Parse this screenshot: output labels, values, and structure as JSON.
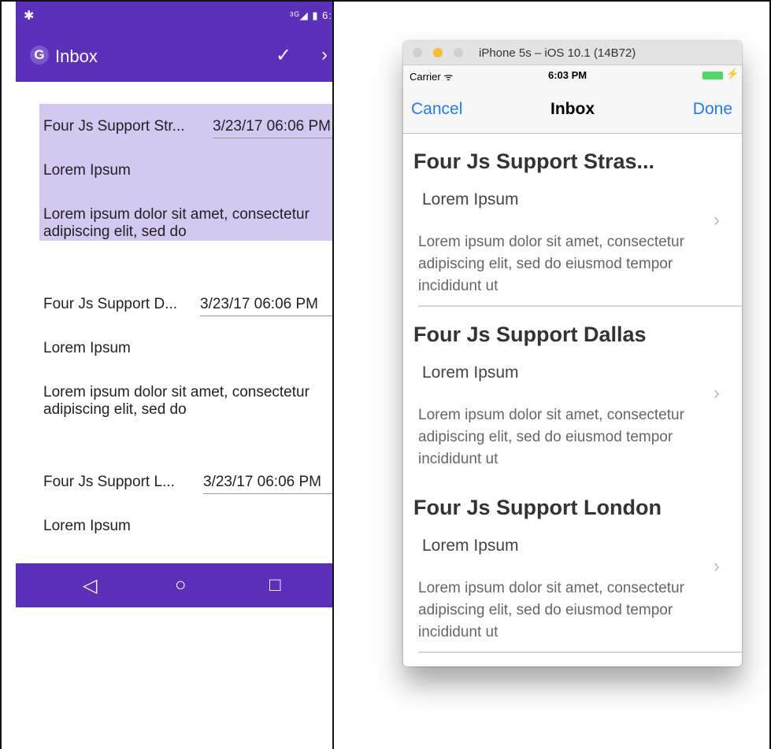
{
  "android": {
    "status_icons": "³ᴳ◢ ▮ 6:",
    "appbar": {
      "logo": "G",
      "title": "Inbox",
      "check": "✓",
      "more": "›"
    },
    "items": [
      {
        "sender": "Four Js Support Str...",
        "date": "3/23/17 06:06 PM",
        "subject": "Lorem Ipsum",
        "body": "Lorem ipsum dolor sit amet, consectetur adipiscing elit, sed do"
      },
      {
        "sender": "Four Js Support D...",
        "date": "3/23/17 06:06 PM",
        "subject": "Lorem Ipsum",
        "body": "Lorem ipsum dolor sit amet, consectetur adipiscing elit, sed do"
      },
      {
        "sender": "Four Js Support L...",
        "date": "3/23/17 06:06 PM",
        "subject": "Lorem Ipsum",
        "body": ""
      }
    ],
    "nav": {
      "back": "◁",
      "home": "○",
      "recents": "□"
    }
  },
  "ios": {
    "window_title": "iPhone 5s – iOS 10.1 (14B72)",
    "status": {
      "carrier": "Carrier ᯤ",
      "time": "6:03 PM",
      "bolt": "⚡"
    },
    "nav": {
      "cancel": "Cancel",
      "title": "Inbox",
      "done": "Done"
    },
    "items": [
      {
        "sender": "Four Js Support Stras...",
        "subject": "Lorem Ipsum",
        "body": "Lorem ipsum dolor sit amet, consectetur adipiscing elit, sed do eiusmod tempor incididunt ut"
      },
      {
        "sender": "Four Js Support Dallas",
        "subject": "Lorem Ipsum",
        "body": "Lorem ipsum dolor sit amet, consectetur adipiscing elit, sed do eiusmod tempor incididunt ut"
      },
      {
        "sender": "Four Js Support London",
        "subject": "Lorem Ipsum",
        "body": "Lorem ipsum dolor sit amet, consectetur adipiscing elit, sed do eiusmod tempor incididunt ut"
      }
    ],
    "chevron": "›"
  },
  "colors": {
    "android_primary": "#5a2fb9",
    "android_selected": "#d3c8ef",
    "ios_tint": "#1e7cf7"
  },
  "icons": {
    "bug": "bug-icon",
    "logo": "app-logo-icon",
    "check": "check-icon",
    "chevron": "chevron-right-icon"
  }
}
